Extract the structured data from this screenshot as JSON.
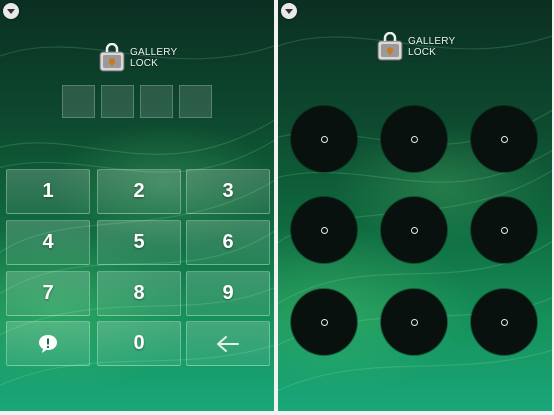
{
  "app": {
    "logo_line1": "GALLERY",
    "logo_line2": "LOCK"
  },
  "pin_screen": {
    "pin_slots": 4,
    "keys": {
      "k1": "1",
      "k2": "2",
      "k3": "3",
      "k4": "4",
      "k5": "5",
      "k6": "6",
      "k7": "7",
      "k8": "8",
      "k9": "9",
      "k0": "0"
    },
    "extra_keys": [
      "hint-icon",
      "backspace-arrow-icon"
    ]
  },
  "pattern_screen": {
    "dot_count": 9
  },
  "colors": {
    "bg_dark": "#0b2f22",
    "bg_light": "#1aa77a",
    "key_text": "#ffffff",
    "pattern_dot": "#08110d"
  },
  "icons": [
    "menu-dropdown-icon",
    "gallery-lock-logo-icon",
    "hint-icon",
    "backspace-arrow-icon"
  ]
}
